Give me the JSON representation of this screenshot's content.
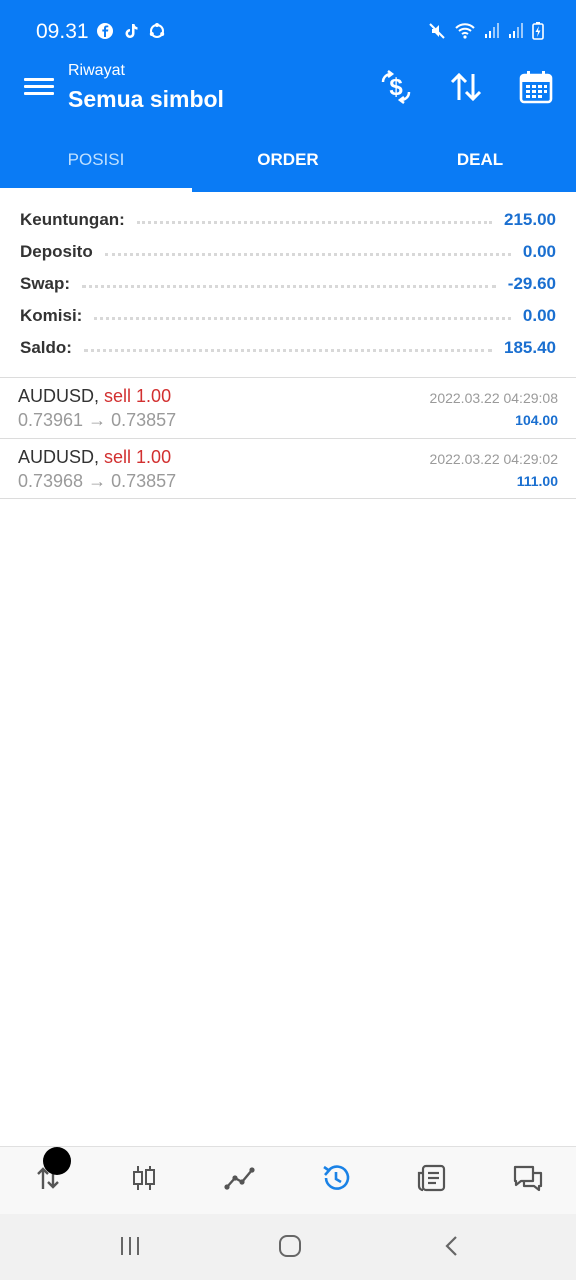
{
  "status_bar": {
    "time": "09.31",
    "left_icons": [
      "facebook-icon",
      "tiktok-icon",
      "sync-icon"
    ],
    "right_icons": [
      "mute-icon",
      "wifi-icon",
      "signal-icon",
      "signal-icon",
      "battery-charging-icon"
    ]
  },
  "app_bar": {
    "subtitle": "Riwayat",
    "title": "Semua simbol",
    "actions": [
      "currency-exchange-icon",
      "sort-icon",
      "calendar-icon"
    ]
  },
  "tabs": [
    {
      "label": "POSISI",
      "active": false
    },
    {
      "label": "ORDER",
      "active": false
    },
    {
      "label": "DEAL",
      "active": false
    }
  ],
  "summary": [
    {
      "label": "Keuntungan:",
      "value": "215.00"
    },
    {
      "label": "Deposito",
      "value": "0.00"
    },
    {
      "label": "Swap:",
      "value": "-29.60"
    },
    {
      "label": "Komisi:",
      "value": "0.00"
    },
    {
      "label": "Saldo:",
      "value": "185.40"
    }
  ],
  "deals": [
    {
      "symbol": "AUDUSD,",
      "side": "sell 1.00",
      "prices": "0.73961 → 0.73857",
      "time": "2022.03.22 04:29:08",
      "profit": "104.00"
    },
    {
      "symbol": "AUDUSD,",
      "side": "sell 1.00",
      "prices": "0.73968 → 0.73857",
      "time": "2022.03.22 04:29:02",
      "profit": "111.00"
    }
  ],
  "bottom_nav": [
    "trade-icon",
    "chart-candles-icon",
    "chart-line-icon",
    "history-icon",
    "news-icon",
    "messages-icon"
  ],
  "active_nav": "history-icon",
  "colors": {
    "primary": "#0a7bf5",
    "profit": "#1a6fd0",
    "sell": "#d23030"
  }
}
